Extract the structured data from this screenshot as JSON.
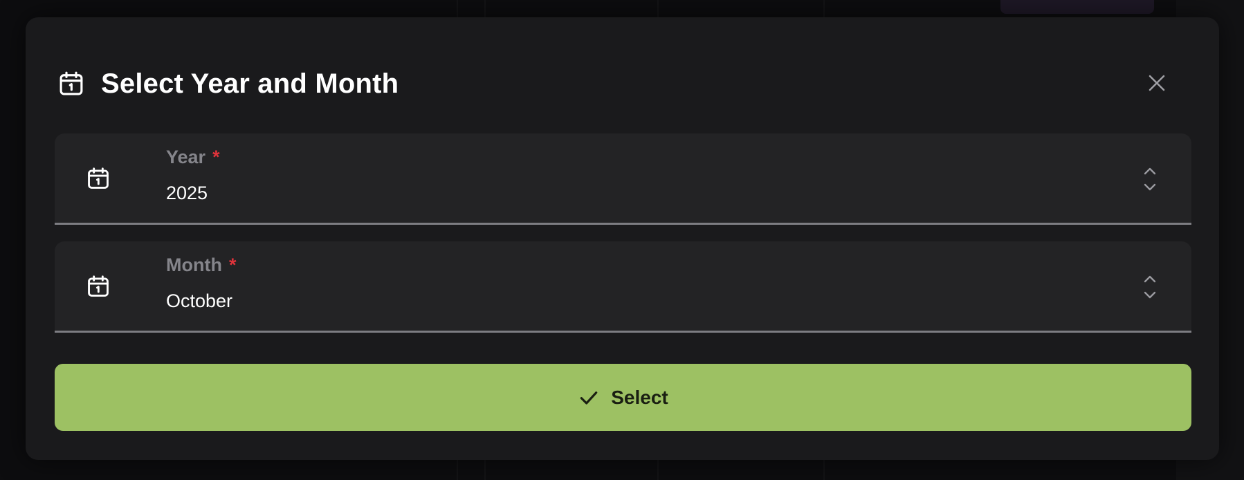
{
  "dialog": {
    "title": "Select Year and Month",
    "header_icon": "calendar-icon",
    "close_icon": "close-icon"
  },
  "fields": {
    "year": {
      "label": "Year",
      "required_mark": "*",
      "value": "2025",
      "icon": "calendar-icon",
      "stepper_icon": "chevron-up-down-icon"
    },
    "month": {
      "label": "Month",
      "required_mark": "*",
      "value": "October",
      "icon": "calendar-icon",
      "stepper_icon": "chevron-up-down-icon"
    }
  },
  "actions": {
    "select_label": "Select",
    "select_icon": "check-icon"
  },
  "colors": {
    "accent": "#9dc163",
    "required": "#e0333b",
    "surface": "#1a1a1c",
    "field_bg": "#232325"
  }
}
